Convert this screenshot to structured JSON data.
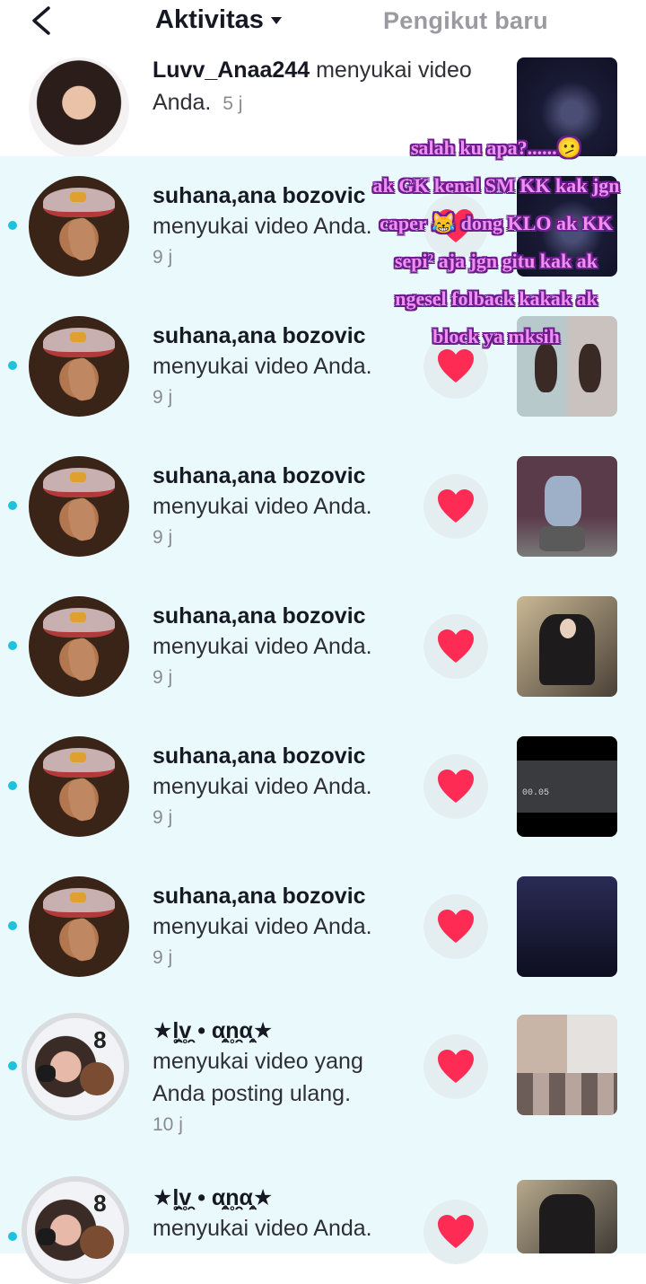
{
  "header": {
    "title": "Aktivitas",
    "right_tab": "Pengikut baru"
  },
  "notifications": [
    {
      "name": "Luvv_Anaa244",
      "action": "menyukai video Anda.",
      "time": "5 j",
      "unread": false,
      "avatar": "girl-portrait",
      "thumbnail": "dark-person-video",
      "has_like": false
    },
    {
      "name": "suhana,ana bozovic",
      "action": "menyukai video Anda.",
      "time": "9 j",
      "unread": true,
      "avatar": "red-cap-face",
      "thumbnail": "dark-person-video",
      "has_like": true
    },
    {
      "name": "suhana,ana bozovic",
      "action": "menyukai video Anda.",
      "time": "9 j",
      "unread": true,
      "avatar": "red-cap-face",
      "thumbnail": "twin-girl-video",
      "has_like": true
    },
    {
      "name": "suhana,ana bozovic",
      "action": "menyukai video Anda.",
      "time": "9 j",
      "unread": true,
      "avatar": "red-cap-face",
      "thumbnail": "dance-video",
      "has_like": true
    },
    {
      "name": "suhana,ana bozovic",
      "action": "menyukai video Anda.",
      "time": "9 j",
      "unread": true,
      "avatar": "red-cap-face",
      "thumbnail": "suit-video",
      "has_like": true
    },
    {
      "name": "suhana,ana bozovic",
      "action": "menyukai video Anda.",
      "time": "9 j",
      "unread": true,
      "avatar": "red-cap-face",
      "thumbnail": "black-video",
      "has_like": true,
      "thumb_caption": "00.05"
    },
    {
      "name": "suhana,ana bozovic",
      "action": "menyukai video Anda.",
      "time": "9 j",
      "unread": true,
      "avatar": "red-cap-face",
      "thumbnail": "navy-video",
      "has_like": true
    },
    {
      "name": "★l̥͙̯v̥̯ • α̥̯n̥̯α̥̯★",
      "action": "menyukai video yang Anda posting ulang.",
      "time": "10 j",
      "unread": true,
      "avatar": "tiktok-ring-avatar",
      "avatar_number": "8",
      "thumbnail": "collage-video",
      "has_like": true
    },
    {
      "name": "★l̥͙̯v̥̯ • α̥̯n̥̯α̥̯★",
      "action": "menyukai video Anda.",
      "time": "",
      "unread": true,
      "avatar": "tiktok-ring-avatar",
      "avatar_number": "8",
      "thumbnail": "suit-video",
      "has_like": true
    }
  ],
  "overlay_text": [
    "salah ku apa?......🫤",
    "ak GK kenal SM KK kak jgn",
    "caper 😹 dong KLO ak KK",
    "sepi² aja jgn gitu kak ak",
    "ngesel folback kakak ak",
    "block ya mksih"
  ],
  "colors": {
    "unread_bg": "#eafafc",
    "unread_dot": "#1cc3dd",
    "heart": "#fe2c55",
    "overlay_fill": "#f08ef2",
    "overlay_outline": "#6a1e8c"
  }
}
